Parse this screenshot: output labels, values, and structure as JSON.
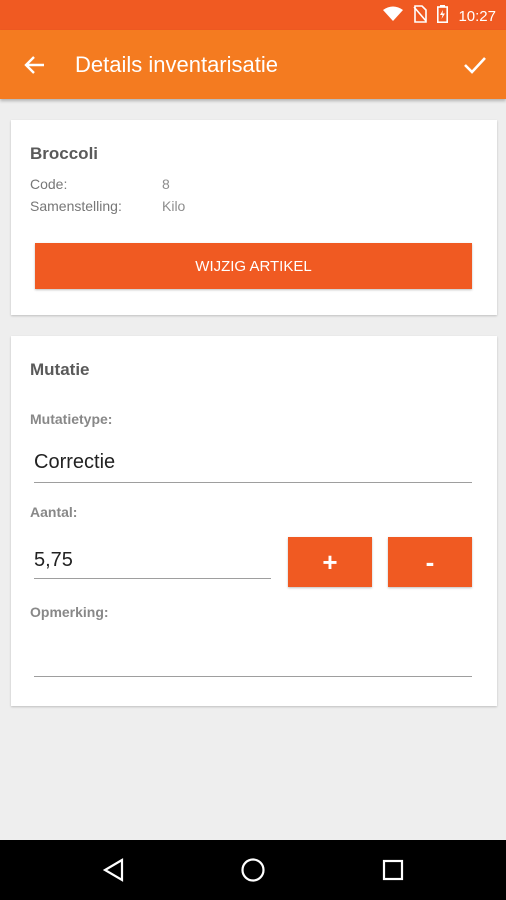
{
  "status_bar": {
    "time": "10:27"
  },
  "toolbar": {
    "title": "Details inventarisatie"
  },
  "article": {
    "name": "Broccoli",
    "code_label": "Code:",
    "code_value": "8",
    "composition_label": "Samenstelling:",
    "composition_value": "Kilo",
    "edit_button": "WIJZIG ARTIKEL"
  },
  "mutation": {
    "title": "Mutatie",
    "type_label": "Mutatietype:",
    "type_value": "Correctie",
    "amount_label": "Aantal:",
    "amount_value": "5,75",
    "plus_label": "+",
    "minus_label": "-",
    "remark_label": "Opmerking:",
    "remark_value": ""
  },
  "colors": {
    "accent": "#f05a22",
    "toolbar": "#f47b20"
  }
}
